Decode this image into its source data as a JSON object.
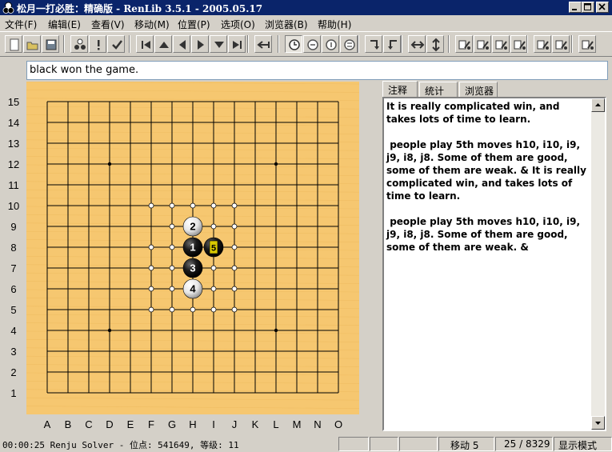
{
  "window": {
    "title": "松月一打必胜：精确版 - RenLib 3.5.1 - 2005.05.17",
    "icon": "renju-app-icon"
  },
  "menu": [
    "文件(F)",
    "编辑(E)",
    "查看(V)",
    "移动(M)",
    "位置(P)",
    "选项(O)",
    "浏览器(B)",
    "帮助(H)"
  ],
  "toolbar": {
    "buttons": [
      "new-icon",
      "open-icon",
      "save-icon",
      "tree-icon",
      "bad-move-icon",
      "good-move-icon",
      "first-move-icon",
      "up-icon",
      "back-icon",
      "forward-icon",
      "down-icon",
      "last-move-icon",
      "back-to-branch-icon",
      "clock-icon",
      "clock-icon-2",
      "clock-icon-3",
      "clock-icon-4",
      "rotate-cw-icon",
      "rotate-ccw-icon",
      "flip-horizontal-icon",
      "flip-vertical-icon",
      "library-icon-1",
      "library-icon-2",
      "library-icon-3",
      "library-icon-4",
      "library-icon-5",
      "library-icon-6",
      "library-icon-7"
    ]
  },
  "comment": "black won the game.",
  "board": {
    "size": 15,
    "row_labels": [
      "15",
      "14",
      "13",
      "12",
      "11",
      "10",
      "9",
      "8",
      "7",
      "6",
      "5",
      "4",
      "3",
      "2",
      "1"
    ],
    "col_labels": [
      "A",
      "B",
      "C",
      "D",
      "E",
      "F",
      "G",
      "H",
      "I",
      "J",
      "K",
      "L",
      "M",
      "N",
      "O"
    ],
    "star_points": [
      "D12",
      "L12",
      "D4",
      "L4"
    ],
    "stones": [
      {
        "move": "1",
        "color": "black",
        "col": "H",
        "row": 8
      },
      {
        "move": "2",
        "color": "white",
        "col": "H",
        "row": 9
      },
      {
        "move": "3",
        "color": "black",
        "col": "H",
        "row": 7
      },
      {
        "move": "4",
        "color": "white",
        "col": "H",
        "row": 6
      },
      {
        "move": "5",
        "color": "black",
        "col": "I",
        "row": 8,
        "highlight": true
      }
    ],
    "marks": [
      "F10",
      "G10",
      "H10",
      "I10",
      "J10",
      "G9",
      "I9",
      "J9",
      "F8",
      "G8",
      "J8",
      "F7",
      "G7",
      "I7",
      "J7",
      "F6",
      "G6",
      "I6",
      "J6",
      "F5",
      "G5",
      "H5",
      "I5",
      "J5"
    ],
    "colors": {
      "board": "#f6c770",
      "line": "#000000",
      "highlight": "#d8c800"
    }
  },
  "tabs": [
    "注释",
    "统计",
    "浏览器"
  ],
  "notes": "It is really complicated win, and takes lots of time to learn.\n\n people play 5th moves h10, i10, i9, j9, i8, j8. Some of them are good, some of them are weak. & It is really complicated win, and takes lots of time to learn.\n\n people play 5th moves h10, i10, i9, j9, i8, j8. Some of them are good, some of them are weak. &",
  "status": {
    "main": "00:00:25 Renju Solver - 位点: 541649, 等级: 11",
    "move": "移动 5",
    "position": "25 / 8329",
    "mode": "显示模式"
  }
}
